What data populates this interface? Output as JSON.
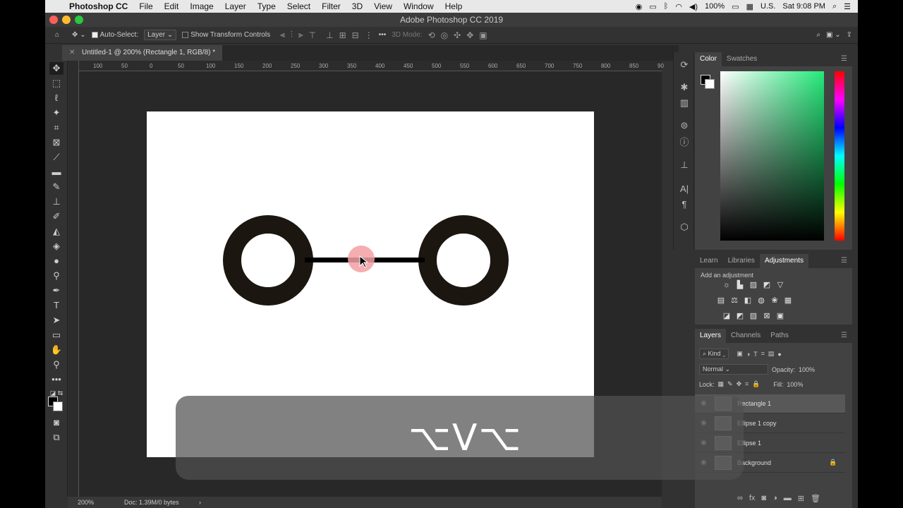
{
  "menubar": {
    "items": [
      "Photoshop CC",
      "File",
      "Edit",
      "Image",
      "Layer",
      "Type",
      "Select",
      "Filter",
      "3D",
      "View",
      "Window",
      "Help"
    ],
    "battery": "100%",
    "input_source": "U.S.",
    "clock": "Sat 9:08 PM"
  },
  "window": {
    "title": "Adobe Photoshop CC 2019"
  },
  "options": {
    "auto_select_label": "Auto-Select:",
    "auto_select_value": "Layer",
    "transform_label": "Show Transform Controls",
    "mode_3d": "3D Mode:",
    "more": "•••"
  },
  "document": {
    "tab_title": "Untitled-1 @ 200% (Rectangle 1, RGB/8) *",
    "zoom": "200%",
    "doc_info": "Doc: 1.39M/0 bytes"
  },
  "ruler": {
    "h_labels": [
      "100",
      "50",
      "0",
      "50",
      "100",
      "150",
      "200",
      "250",
      "300",
      "350",
      "400",
      "450",
      "500",
      "550",
      "600",
      "650",
      "700",
      "750",
      "800",
      "850",
      "90"
    ]
  },
  "color_panel": {
    "tabs": [
      "Color",
      "Swatches"
    ]
  },
  "adjust_panel": {
    "tabs": [
      "Learn",
      "Libraries",
      "Adjustments"
    ],
    "hint": "Add an adjustment"
  },
  "layers_panel": {
    "tabs": [
      "Layers",
      "Channels",
      "Paths"
    ],
    "filter": "Kind",
    "blend_mode": "Normal",
    "opacity_label": "Opacity:",
    "opacity": "100%",
    "lock_label": "Lock:",
    "fill_label": "Fill:",
    "fill": "100%",
    "layers": [
      {
        "name": "Rectangle 1",
        "selected": true
      },
      {
        "name": "Ellipse 1 copy",
        "selected": false
      },
      {
        "name": "Ellipse 1",
        "selected": false
      },
      {
        "name": "Background",
        "selected": false,
        "locked": true
      }
    ]
  },
  "shortcut": {
    "keys": "⌥V⌥"
  },
  "colors": {
    "accent": "#1473e6",
    "shape": "#1c1611",
    "cursor_highlight": "#f2a0a4"
  }
}
